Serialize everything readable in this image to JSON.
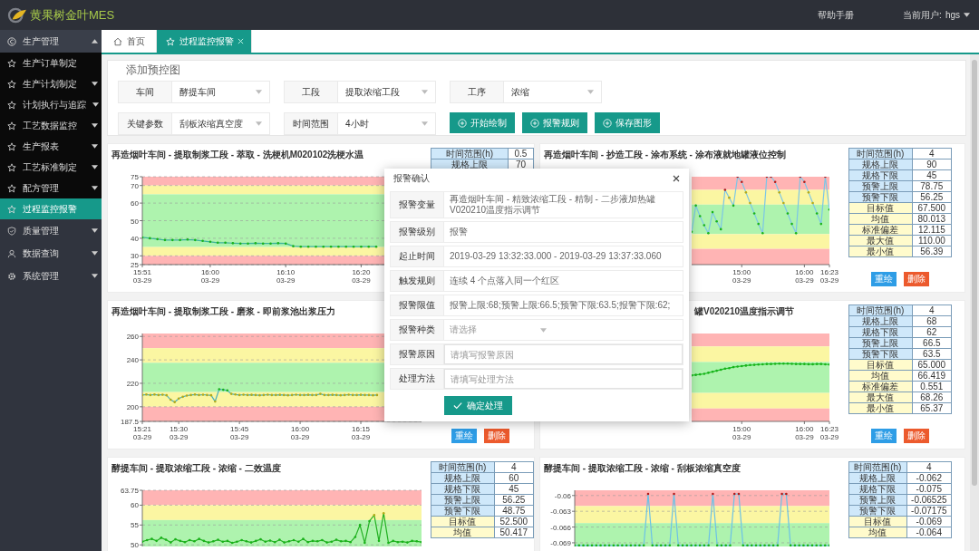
{
  "app": {
    "title": "黄果树金叶MES"
  },
  "header": {
    "help": "帮助手册",
    "user_label": "当前用户:",
    "user": "hgs"
  },
  "sidebar": {
    "items": [
      {
        "label": "生产管理",
        "expanded": true,
        "children": [
          {
            "label": "生产订单制定",
            "expandable": false,
            "selected": false
          },
          {
            "label": "生产计划制定",
            "expandable": true,
            "selected": false
          },
          {
            "label": "计划执行与追踪",
            "expandable": true,
            "selected": false
          },
          {
            "label": "工艺数据监控",
            "expandable": true,
            "selected": false
          },
          {
            "label": "生产报表",
            "expandable": true,
            "selected": false
          },
          {
            "label": "工艺标准制定",
            "expandable": true,
            "selected": false
          },
          {
            "label": "配方管理",
            "expandable": true,
            "selected": false
          },
          {
            "label": "过程监控报警",
            "expandable": false,
            "selected": true
          }
        ]
      },
      {
        "label": "质量管理",
        "expanded": false
      },
      {
        "label": "数据查询",
        "expanded": false
      },
      {
        "label": "系统管理",
        "expanded": false
      }
    ]
  },
  "tabs": [
    {
      "label": "首页",
      "selected": false,
      "closable": false
    },
    {
      "label": "过程监控报警",
      "selected": true,
      "closable": true
    }
  ],
  "filter": {
    "legend": "添加预控图",
    "fields": [
      {
        "label": "车间",
        "value": "酵提车间"
      },
      {
        "label": "工段",
        "value": "提取浓缩工段"
      },
      {
        "label": "工序",
        "value": "浓缩"
      },
      {
        "label": "关键参数",
        "value": "刮板浓缩真空度"
      },
      {
        "label": "时间范围",
        "value": "4小时"
      }
    ],
    "buttons": [
      "开始绘制",
      "报警规则",
      "保存图形"
    ]
  },
  "panels": [
    {
      "chart_data": {
        "type": "line",
        "title": "再造烟叶车间 - 提取制浆工段 - 萃取 - 洗梗机M020102洗梗水温",
        "grid": true,
        "categories": [
          "15:51 03-29",
          null,
          null,
          null,
          null,
          null,
          null,
          null,
          null,
          "16:00 03-29",
          null,
          null,
          null,
          null,
          null,
          null,
          null,
          null,
          null,
          "16:10 03-29",
          null,
          null,
          null,
          null,
          null,
          null,
          null,
          null,
          null,
          "16:20 03-29",
          null,
          null,
          null,
          null,
          null,
          null,
          null,
          null
        ],
        "ylim": [
          25,
          75
        ],
        "yticks": [
          25,
          30,
          40,
          50,
          60,
          70,
          75
        ],
        "bands": [
          {
            "axis": "y",
            "from": 70,
            "to": 75,
            "color": "#ffb4b4"
          },
          {
            "axis": "y",
            "from": 65,
            "to": 70,
            "color": "#fbf6a2"
          },
          {
            "axis": "y",
            "from": 35,
            "to": 65,
            "color": "#aef3ae"
          },
          {
            "axis": "y",
            "from": 30,
            "to": 35,
            "color": "#fbf6a2"
          },
          {
            "axis": "y",
            "from": 25,
            "to": 30,
            "color": "#ffb4b4"
          }
        ],
        "series": [
          {
            "color": "#3cb49c",
            "values": [
              40.5,
              40,
              39.5,
              39,
              39,
              39,
              39.3,
              39,
              38.5,
              38,
              37.5,
              37.5,
              37.2,
              37,
              37,
              37.2,
              37,
              37,
              37.2,
              37,
              35.5,
              35.2,
              35.2,
              35.2,
              35.2,
              35.2,
              35.2,
              35.2,
              35.2,
              35.2,
              35.2,
              35.2,
              null,
              null,
              null,
              null,
              null,
              null
            ]
          }
        ]
      },
      "stats": [
        {
          "label": "时间范围(h)",
          "value": "0.5",
          "kind": "limit"
        },
        {
          "label": "规格上限",
          "value": "70",
          "kind": "limit"
        }
      ]
    },
    {
      "chart": {
        "title": "再造烟叶车间 - 抄造工段 - 涂布系统 - 涂布液就地罐液位控制",
        "x_labels": [
          "15:00 03-29",
          "16:00 03-29",
          "16:23 03-29"
        ]
      },
      "stats": [
        {
          "label": "时间范围(h)",
          "value": "4",
          "kind": "limit"
        },
        {
          "label": "规格上限",
          "value": "90",
          "kind": "limit"
        },
        {
          "label": "规格下限",
          "value": "45",
          "kind": "limit"
        },
        {
          "label": "预警上限",
          "value": "78.75",
          "kind": "limit"
        },
        {
          "label": "预警下限",
          "value": "56.25",
          "kind": "limit"
        },
        {
          "label": "目标值",
          "value": "67.500",
          "kind": "stat"
        },
        {
          "label": "均值",
          "value": "80.013",
          "kind": "stat"
        },
        {
          "label": "标准偏差",
          "value": "12.115",
          "kind": "stat"
        },
        {
          "label": "最大值",
          "value": "110.00",
          "kind": "stat"
        },
        {
          "label": "最小值",
          "value": "56.39",
          "kind": "stat"
        }
      ],
      "buttons": [
        {
          "label": "重绘",
          "kind": "redraw"
        },
        {
          "label": "删除",
          "kind": "delete"
        }
      ]
    },
    {
      "chart_data": {
        "type": "line",
        "title": "再造烟叶车间 - 提取制浆工段 - 磨浆 - 即前浆池出浆压力",
        "grid": true,
        "categories": [
          "15:21 03-29",
          null,
          null,
          null,
          null,
          null,
          null,
          null,
          null,
          "15:30 03-29",
          null,
          null,
          null,
          null,
          null,
          null,
          null,
          null,
          null,
          null,
          null,
          null,
          null,
          null,
          "15:45 03-29",
          null,
          null,
          null,
          null,
          null,
          null,
          null,
          null,
          null,
          null,
          null,
          null,
          null,
          null,
          "16:00 03-29",
          null,
          null,
          null,
          null,
          null,
          null,
          null,
          null,
          null,
          null,
          null,
          null,
          null,
          null,
          "16:15 03-29",
          null,
          null,
          null,
          null,
          null,
          null,
          null,
          null,
          null,
          null,
          null,
          null,
          null,
          null,
          null
        ],
        "ylim": [
          187.5,
          262.5
        ],
        "yticks": [
          187.5,
          200,
          220,
          240,
          260
        ],
        "bands": [
          {
            "axis": "y",
            "from": 250,
            "to": 262.5,
            "color": "#ffb4b4"
          },
          {
            "axis": "y",
            "from": 237.5,
            "to": 250,
            "color": "#fbf6a2"
          },
          {
            "axis": "y",
            "from": 212.5,
            "to": 237.5,
            "color": "#aef3ae"
          },
          {
            "axis": "y",
            "from": 200,
            "to": 212.5,
            "color": "#fbf6a2"
          },
          {
            "axis": "y",
            "from": 187.5,
            "to": 200,
            "color": "#ffb4b4"
          }
        ],
        "series": [
          {
            "color": "#48aebe",
            "values": [
              210,
              210.5,
              210,
              210.5,
              210,
              210.3,
              209.8,
              206,
              204,
              207,
              208.5,
              209.5,
              210,
              210.5,
              210,
              210.3,
              210,
              209.8,
              204.5,
              215,
              214.5,
              214,
              211,
              210.5,
              210,
              210.3,
              210,
              210.2,
              210,
              209.8,
              210,
              210.3,
              210,
              210,
              210.2,
              210,
              209.8,
              210,
              210.3,
              210,
              210,
              210.2,
              210,
              210,
              211,
              210,
              210,
              210.2,
              210,
              209.8,
              210,
              210.3,
              210,
              210,
              210.2,
              210,
              210,
              209.8,
              210,
              null,
              null,
              null,
              null,
              null,
              null,
              null,
              null,
              null,
              null,
              null
            ]
          }
        ]
      },
      "buttons": [
        {
          "label": "重绘",
          "kind": "redraw"
        },
        {
          "label": "删除",
          "kind": "delete"
        }
      ]
    },
    {
      "chart": {
        "title": "罐V020210温度指示调节",
        "x_labels": [
          "15:00 03-29",
          "16:00 03-29",
          "16:23 03-29"
        ]
      },
      "stats": [
        {
          "label": "时间范围(h)",
          "value": "4",
          "kind": "limit"
        },
        {
          "label": "规格上限",
          "value": "68",
          "kind": "limit"
        },
        {
          "label": "规格下限",
          "value": "62",
          "kind": "limit"
        },
        {
          "label": "预警上限",
          "value": "66.5",
          "kind": "limit"
        },
        {
          "label": "预警下限",
          "value": "63.5",
          "kind": "limit"
        },
        {
          "label": "目标值",
          "value": "65.000",
          "kind": "stat"
        },
        {
          "label": "均值",
          "value": "66.419",
          "kind": "stat"
        },
        {
          "label": "标准偏差",
          "value": "0.551",
          "kind": "stat"
        },
        {
          "label": "最大值",
          "value": "68.26",
          "kind": "stat"
        },
        {
          "label": "最小值",
          "value": "65.37",
          "kind": "stat"
        }
      ],
      "buttons": [
        {
          "label": "重绘",
          "kind": "redraw"
        },
        {
          "label": "删除",
          "kind": "delete"
        }
      ]
    },
    {
      "chart_data": {
        "type": "line",
        "title": "酵提车间 - 提取浓缩工段 - 浓缩 - 二效温度",
        "grid": true,
        "ylim": [
          49.6,
          63.75
        ],
        "yticks": [
          63.75,
          60,
          55,
          50
        ],
        "bands": [
          {
            "axis": "y",
            "from": 60,
            "to": 63.75,
            "color": "#ffb4b4"
          },
          {
            "axis": "y",
            "from": 56.25,
            "to": 60,
            "color": "#fbf6a2"
          },
          {
            "axis": "y",
            "from": 48.75,
            "to": 56.25,
            "color": "#aef3ae"
          }
        ],
        "series": [
          {
            "color": "#22b022",
            "values": [
              50.8,
              51.2,
              51.5,
              51,
              51.8,
              51.3,
              50.6,
              51.4,
              51,
              50.7,
              51.2,
              50.9,
              51.5,
              51,
              50.6,
              50.9,
              51.3,
              50.8,
              51,
              50.5,
              50.8,
              51.2,
              50.9,
              50.6,
              51,
              51.4,
              50.8,
              51.1,
              50.7,
              51.3,
              50.6,
              50.9,
              51.2,
              50.8,
              51.5,
              50.7,
              51,
              50.9,
              51.2,
              50.6,
              50.8,
              51.3,
              50.9,
              51,
              50.7,
              52,
              55,
              50.5,
              56,
              57.5,
              51,
              58,
              50.5,
              51,
              50.7,
              50.8,
              50.6,
              51,
              50.9,
              50.7
            ]
          }
        ]
      },
      "stats": [
        {
          "label": "时间范围(h)",
          "value": "4",
          "kind": "limit"
        },
        {
          "label": "规格上限",
          "value": "60",
          "kind": "limit"
        },
        {
          "label": "规格下限",
          "value": "45",
          "kind": "limit"
        },
        {
          "label": "预警上限",
          "value": "56.25",
          "kind": "limit"
        },
        {
          "label": "预警下限",
          "value": "48.75",
          "kind": "limit"
        },
        {
          "label": "目标值",
          "value": "52.500",
          "kind": "stat"
        },
        {
          "label": "均值",
          "value": "50.417",
          "kind": "stat"
        }
      ]
    },
    {
      "chart_data": {
        "type": "line",
        "title": "酵提车间 - 提取浓缩工段 - 浓缩 - 刮板浓缩真空度",
        "grid": true,
        "ylim": [
          -0.0697,
          -0.059
        ],
        "yticks": [
          -0.06,
          -0.063,
          -0.066,
          -0.069
        ],
        "bands": [
          {
            "axis": "y",
            "from": -0.062,
            "to": -0.059,
            "color": "#ffb4b4"
          },
          {
            "axis": "y",
            "from": -0.06525,
            "to": -0.062,
            "color": "#fbf6a2"
          },
          {
            "axis": "y",
            "from": -0.07175,
            "to": -0.06525,
            "color": "#aef3ae"
          }
        ],
        "series": [
          {
            "color": "#6cc2e6",
            "values": [
              -0.0695,
              -0.0695,
              -0.0695,
              -0.0695,
              -0.0695,
              -0.0695,
              -0.0695,
              -0.0695,
              -0.0695,
              -0.0695,
              -0.0695,
              -0.0695,
              -0.0695,
              -0.0695,
              -0.0695,
              -0.0695,
              -0.0695,
              -0.0597,
              -0.0695,
              -0.0695,
              -0.0695,
              -0.0695,
              -0.0695,
              -0.0597,
              -0.0695,
              -0.0695,
              -0.0695,
              -0.0695,
              -0.0695,
              -0.0695,
              -0.0695,
              -0.0695,
              -0.0597,
              -0.0695,
              -0.0695,
              -0.0695,
              -0.0695,
              -0.0597,
              -0.0597,
              -0.0695,
              -0.0695,
              -0.0695,
              -0.0695,
              -0.0695,
              -0.0695,
              -0.0695,
              -0.0695,
              -0.0695,
              -0.0597,
              -0.0597,
              -0.0695,
              -0.0695,
              -0.0695,
              -0.0695,
              -0.0695,
              -0.0695,
              -0.0695,
              -0.0695,
              -0.0695,
              -0.0695
            ]
          }
        ]
      },
      "stats": [
        {
          "label": "时间范围(h)",
          "value": "4",
          "kind": "limit"
        },
        {
          "label": "规格上限",
          "value": "-0.062",
          "kind": "limit"
        },
        {
          "label": "规格下限",
          "value": "-0.075",
          "kind": "limit"
        },
        {
          "label": "预警上限",
          "value": "-0.06525",
          "kind": "limit"
        },
        {
          "label": "预警下限",
          "value": "-0.07175",
          "kind": "limit"
        },
        {
          "label": "目标值",
          "value": "-0.069",
          "kind": "stat"
        },
        {
          "label": "均值",
          "value": "-0.064",
          "kind": "stat"
        }
      ]
    }
  ],
  "dialog": {
    "title": "报警确认",
    "fields": [
      {
        "label": "报警变量",
        "kind": "text",
        "value": "再造烟叶车间 - 精致浓缩工段 - 精制 - 二步液加热罐V020210温度指示调节"
      },
      {
        "label": "报警级别",
        "kind": "text",
        "value": "报警"
      },
      {
        "label": "起止时间",
        "kind": "text",
        "value": "2019-03-29 13:32:33.000 - 2019-03-29 13:37:33.060"
      },
      {
        "label": "触发规则",
        "kind": "text",
        "value": "连续 4 个点落入同一个红区"
      },
      {
        "label": "报警限值",
        "kind": "text",
        "value": "报警上限:68;预警上限:66.5;预警下限:63.5;报警下限:62;"
      },
      {
        "label": "报警种类",
        "kind": "select",
        "placeholder": "请选择"
      },
      {
        "label": "报警原因",
        "kind": "input",
        "placeholder": "请填写报警原因"
      },
      {
        "label": "处理方法",
        "kind": "input",
        "placeholder": "请填写处理方法"
      }
    ],
    "button": "确定处理"
  }
}
